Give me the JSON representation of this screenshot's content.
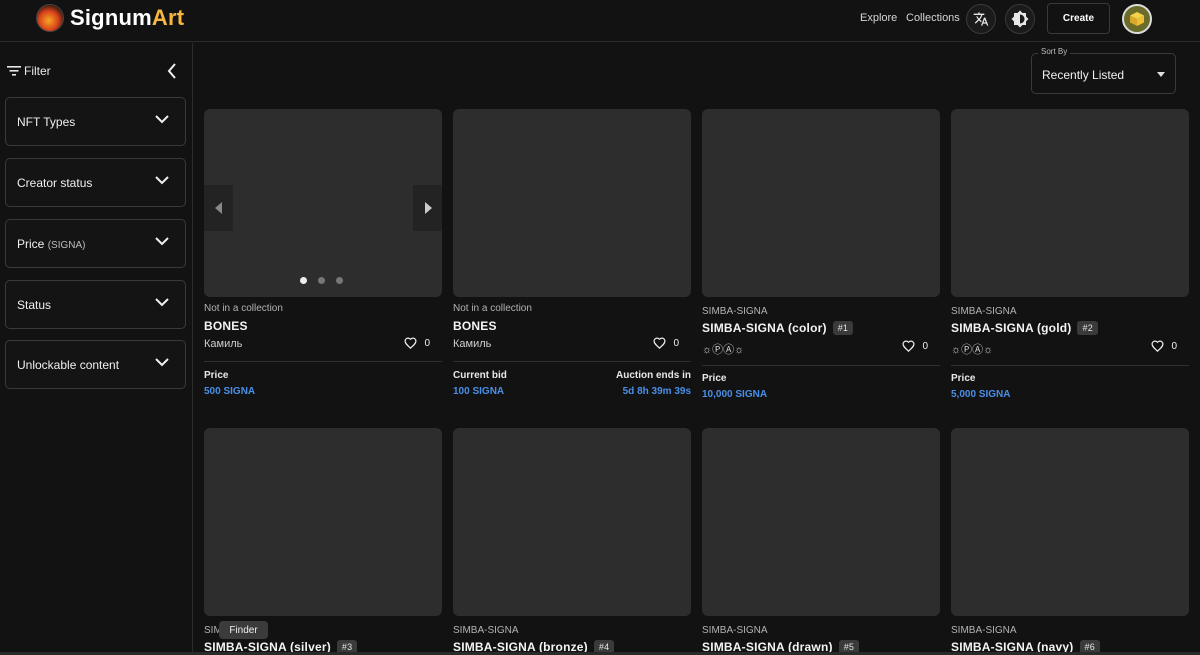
{
  "header": {
    "brand_prefix": "Signum",
    "brand_suffix": "Art",
    "nav": [
      "Explore",
      "Collections"
    ],
    "create_label": "Create",
    "icons": [
      "translate-icon",
      "brightness-icon",
      "avatar-cube-icon"
    ]
  },
  "sidebar": {
    "filter_label": "Filter",
    "filters": [
      {
        "label": "NFT Types",
        "sub": ""
      },
      {
        "label": "Creator status",
        "sub": ""
      },
      {
        "label": "Price",
        "sub": "(SIGNA)"
      },
      {
        "label": "Status",
        "sub": ""
      },
      {
        "label": "Unlockable content",
        "sub": ""
      }
    ]
  },
  "sort": {
    "label": "Sort By",
    "value": "Recently Listed"
  },
  "cards": [
    {
      "collection": "Not in a collection",
      "name": "BONES",
      "badge": "",
      "creator": "Камиль",
      "likes": "0",
      "left_label": "Price",
      "left_value": "500 SIGNA",
      "right_label": "",
      "right_value": ""
    },
    {
      "collection": "Not in a collection",
      "name": "BONES",
      "badge": "",
      "creator": "Камиль",
      "likes": "0",
      "left_label": "Current bid",
      "left_value": "100 SIGNA",
      "right_label": "Auction ends in",
      "right_value": "5d 8h 39m 39s"
    },
    {
      "collection": "SIMBA-SIGNA",
      "name": "SIMBA-SIGNA (color)",
      "badge": "#1",
      "creator": "☼ⓅⒶ☼",
      "likes": "0",
      "left_label": "Price",
      "left_value": "10,000 SIGNA",
      "right_label": "",
      "right_value": ""
    },
    {
      "collection": "SIMBA-SIGNA",
      "name": "SIMBA-SIGNA (gold)",
      "badge": "#2",
      "creator": "☼ⓅⒶ☼",
      "likes": "0",
      "left_label": "Price",
      "left_value": "5,000 SIGNA",
      "right_label": "",
      "right_value": ""
    },
    {
      "collection": "SIM",
      "name": "SIMBA-SIGNA (silver)",
      "badge": "#3"
    },
    {
      "collection": "SIMBA-SIGNA",
      "name": "SIMBA-SIGNA (bronze)",
      "badge": "#4"
    },
    {
      "collection": "SIMBA-SIGNA",
      "name": "SIMBA-SIGNA (drawn)",
      "badge": "#5"
    },
    {
      "collection": "SIMBA-SIGNA",
      "name": "SIMBA-SIGNA (navy)",
      "badge": "#6"
    }
  ],
  "tooltip": "Finder"
}
